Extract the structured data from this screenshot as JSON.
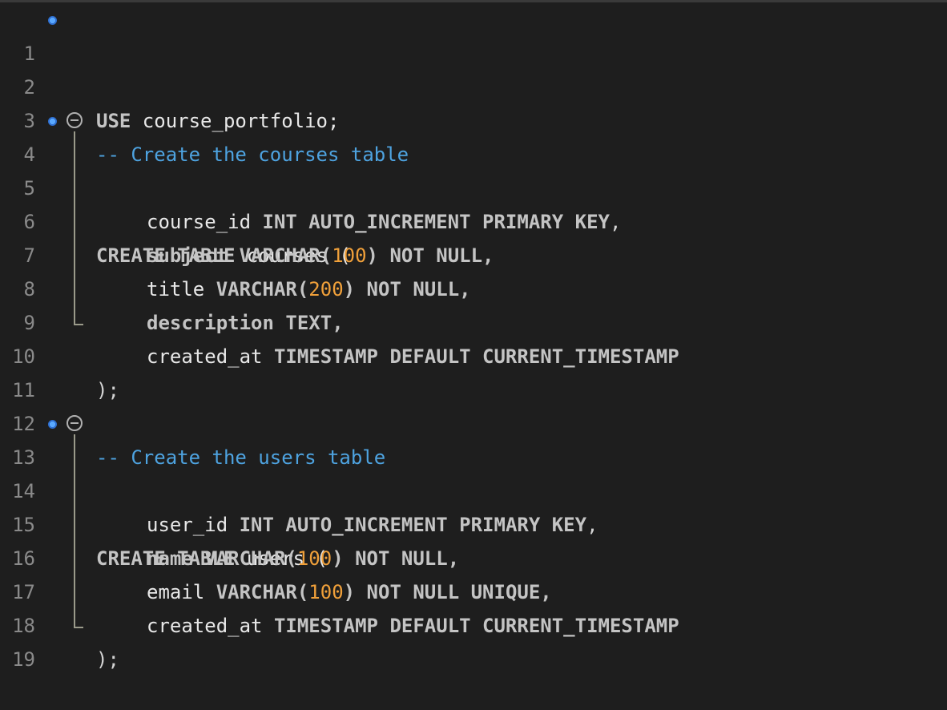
{
  "editor": {
    "lines": [
      {
        "num": "1",
        "code": "USE course_portfolio;"
      },
      {
        "num": "2",
        "code": ""
      },
      {
        "num": "3",
        "code": "-- Create the courses table"
      },
      {
        "num": "4",
        "code": "CREATE TABLE courses ("
      },
      {
        "num": "5",
        "code": "course_id INT AUTO_INCREMENT PRIMARY KEY,"
      },
      {
        "num": "6",
        "code": "subject VARCHAR(100) NOT NULL,"
      },
      {
        "num": "7",
        "code": "title VARCHAR(200) NOT NULL,"
      },
      {
        "num": "8",
        "code": "description TEXT,"
      },
      {
        "num": "9",
        "code": "created_at TIMESTAMP DEFAULT CURRENT_TIMESTAMP"
      },
      {
        "num": "10",
        "code": ");"
      },
      {
        "num": "11",
        "code": ""
      },
      {
        "num": "12",
        "code": "-- Create the users table"
      },
      {
        "num": "13",
        "code": "CREATE TABLE users ("
      },
      {
        "num": "14",
        "code": "user_id INT AUTO_INCREMENT PRIMARY KEY,"
      },
      {
        "num": "15",
        "code": "name VARCHAR(100) NOT NULL,"
      },
      {
        "num": "16",
        "code": "email VARCHAR(100) NOT NULL UNIQUE,"
      },
      {
        "num": "17",
        "code": "created_at TIMESTAMP DEFAULT CURRENT_TIMESTAMP"
      },
      {
        "num": "18",
        "code": ");"
      },
      {
        "num": "19",
        "code": ""
      }
    ],
    "tokens": {
      "l1": [
        "USE",
        " course_portfolio;"
      ],
      "l3": [
        "-- Create the courses table"
      ],
      "l4": [
        "CREATE TABLE",
        " courses ("
      ],
      "l5": [
        "course_id",
        " INT AUTO_INCREMENT PRIMARY KEY",
        ","
      ],
      "l6": [
        "subject VARCHAR(",
        "100",
        ") NOT NULL,"
      ],
      "l7": [
        "title",
        " VARCHAR(",
        "200",
        ") NOT NULL,"
      ],
      "l8": [
        "description TEXT,"
      ],
      "l9": [
        "created_at",
        " TIMESTAMP DEFAULT CURRENT_TIMESTAMP"
      ],
      "l10": [
        ");"
      ],
      "l12": [
        "-- Create the users table"
      ],
      "l13": [
        "CREATE TABLE",
        " users ("
      ],
      "l14": [
        "user_id",
        " INT AUTO_INCREMENT PRIMARY KEY",
        ","
      ],
      "l15": [
        "name VARCHAR(",
        "100",
        ") NOT NULL,"
      ],
      "l16": [
        "email",
        " VARCHAR(",
        "100",
        ") NOT NULL UNIQUE,"
      ],
      "l17": [
        "created_at",
        " TIMESTAMP DEFAULT CURRENT_TIMESTAMP"
      ],
      "l18": [
        ");"
      ]
    },
    "colors": {
      "background": "#1e1e1e",
      "comment": "#4ea3e0",
      "number": "#f0a03a",
      "keyword": "#c4c4c4",
      "line_number": "#8a8a8a",
      "breakpoint": "#3b82f6"
    }
  }
}
